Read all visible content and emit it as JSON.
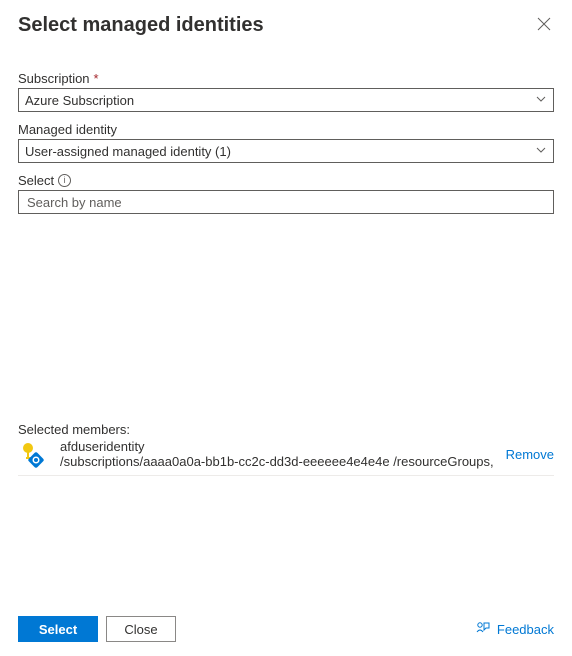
{
  "header": {
    "title": "Select managed identities"
  },
  "form": {
    "subscription": {
      "label": "Subscription",
      "required": "*",
      "value": "Azure Subscription"
    },
    "managedIdentity": {
      "label": "Managed identity",
      "value": "User-assigned managed identity (1)"
    },
    "select": {
      "label": "Select",
      "placeholder": "Search by name",
      "value": ""
    }
  },
  "selected": {
    "heading": "Selected members:",
    "members": [
      {
        "name": "afduseridentity",
        "path": "/subscriptions/aaaa0a0a-bb1b-cc2c-dd3d-eeeeee4e4e4e /resourceGroups,"
      }
    ],
    "removeLabel": "Remove"
  },
  "footer": {
    "select": "Select",
    "close": "Close",
    "feedback": "Feedback"
  }
}
